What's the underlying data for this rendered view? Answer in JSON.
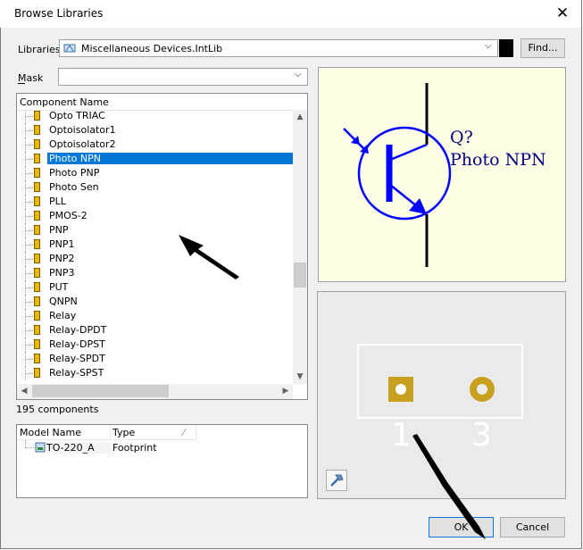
{
  "window": {
    "title": "Browse Libraries",
    "close_glyph": "✕"
  },
  "libraries": {
    "label": "Libraries",
    "value": "Miscellaneous Devices.IntLib",
    "find_button": "Find..."
  },
  "mask": {
    "label": "Mask",
    "value": ""
  },
  "component_list": {
    "header": "Component Name",
    "items": [
      "Opto TRIAC",
      "Optoisolator1",
      "Optoisolator2",
      "Photo NPN",
      "Photo PNP",
      "Photo Sen",
      "PLL",
      "PMOS-2",
      "PNP",
      "PNP1",
      "PNP2",
      "PNP3",
      "PUT",
      "QNPN",
      "Relay",
      "Relay-DPDT",
      "Relay-DPST",
      "Relay-SPDT",
      "Relay-SPST"
    ],
    "selected": "Photo NPN",
    "count_text": "195 components"
  },
  "model_table": {
    "columns": [
      "Model Name",
      "Type"
    ],
    "rows": [
      {
        "name": "TO-220_A",
        "type": "Footprint"
      }
    ]
  },
  "symbol_preview": {
    "designator": "Q?",
    "comment": "Photo NPN"
  },
  "footprint_preview": {
    "pad1": "1",
    "pad2": "3"
  },
  "buttons": {
    "ok": "OK",
    "cancel": "Cancel"
  },
  "colors": {
    "selection": "#0078d7",
    "symbol_bg": "#ffffe6",
    "symbol_line": "#0000ff",
    "pad": "#c8a020"
  }
}
